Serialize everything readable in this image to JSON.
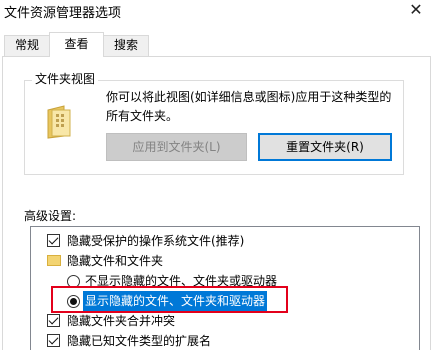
{
  "window": {
    "title": "文件资源管理器选项",
    "close_glyph": "✕"
  },
  "tabs": [
    {
      "label": "常规"
    },
    {
      "label": "查看"
    },
    {
      "label": "搜索"
    }
  ],
  "folder_views": {
    "group_label": "文件夹视图",
    "description": "你可以将此视图(如详细信息或图标)应用于这种类型的所有文件夹。",
    "apply_button": "应用到文件夹(L)",
    "reset_button": "重置文件夹(R)"
  },
  "advanced": {
    "label": "高级设置:",
    "items": [
      {
        "type": "checkbox",
        "checked": true,
        "label": "隐藏受保护的操作系统文件(推荐)"
      },
      {
        "type": "folder",
        "label": "隐藏文件和文件夹"
      },
      {
        "type": "radio",
        "checked": false,
        "label": "不显示隐藏的文件、文件夹或驱动器"
      },
      {
        "type": "radio",
        "checked": true,
        "label": "显示隐藏的文件、文件夹和驱动器"
      },
      {
        "type": "checkbox",
        "checked": true,
        "label": "隐藏文件夹合并冲突"
      },
      {
        "type": "checkbox",
        "checked": true,
        "label": "隐藏已知文件类型的扩展名"
      }
    ]
  },
  "colors": {
    "accent": "#0078d7",
    "annotation_red": "#e3001b"
  }
}
